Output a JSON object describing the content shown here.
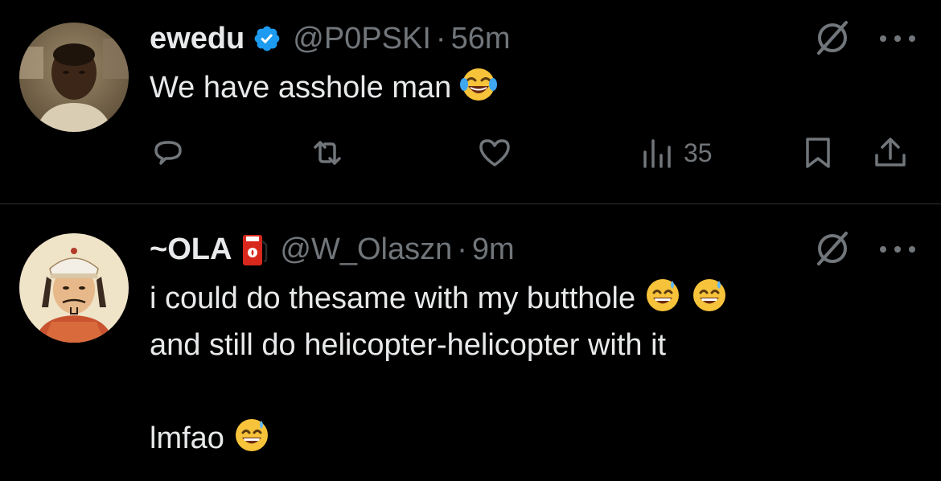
{
  "colors": {
    "background": "#000000",
    "text_primary": "#e7e9ea",
    "text_secondary": "#71767b",
    "verified": "#1d9bf0",
    "divider": "#2f3336"
  },
  "tweets": [
    {
      "display_name": "ewedu",
      "handle": "@P0PSKI",
      "separator": "·",
      "time": "56m",
      "verified_icon": "verified-badge-icon",
      "text": "We have asshole man",
      "emoji": "face-with-tears-of-joy",
      "actions": {
        "reply_icon": "reply-icon",
        "retweet_icon": "retweet-icon",
        "like_icon": "heart-icon",
        "views_icon": "views-bar-chart-icon",
        "views_count": "35",
        "bookmark_icon": "bookmark-icon",
        "share_icon": "share-icon"
      }
    },
    {
      "display_name": "~OLA",
      "handle": "@W_Olaszn",
      "separator": "·",
      "time": "9m",
      "name_emoji": "fuel-pump",
      "text_line1": "i could do thesame with my butthole",
      "text_line2": "and still do helicopter-helicopter with it",
      "text_line3": "",
      "text_line4": "lmfao",
      "emoji": "grinning-face-with-sweat"
    }
  ]
}
